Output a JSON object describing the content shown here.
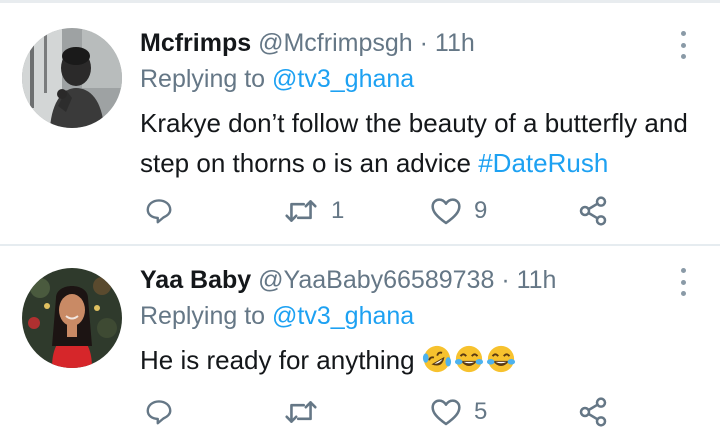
{
  "tweets": [
    {
      "name": "Mcfrimps",
      "handle": "@Mcfrimpsgh",
      "separator": "·",
      "time": "11h",
      "reply_prefix": "Replying to ",
      "reply_to": "@tv3_ghana",
      "text": "Krakye don’t follow the beauty of a butterfly and step on thorns o is an advice ",
      "hashtag": "#DateRush",
      "retweets": "1",
      "likes": "9"
    },
    {
      "name": "Yaa Baby",
      "handle": "@YaaBaby66589738",
      "separator": "·",
      "time": "11h",
      "reply_prefix": "Replying to ",
      "reply_to": "@tv3_ghana",
      "text": "He is ready for anything ",
      "emojis": [
        "rolling-on-floor-laughing-emoji",
        "tears-of-joy-emoji",
        "tears-of-joy-emoji"
      ],
      "retweets": "",
      "likes": "5"
    }
  ],
  "icons": {
    "reply": "reply-icon",
    "retweet": "retweet-icon",
    "like": "heart-icon",
    "share": "share-icon",
    "menu": "more-vertical-icon"
  },
  "colors": {
    "link": "#1da1f2",
    "muted": "#657786",
    "text": "#14171a"
  }
}
